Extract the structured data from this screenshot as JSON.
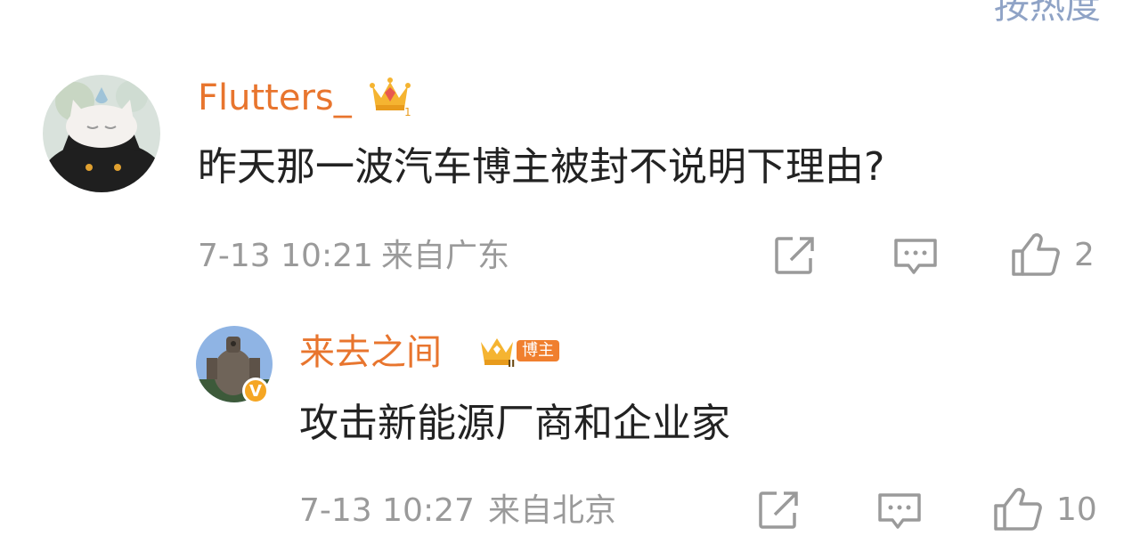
{
  "top_partial_text": "按热度",
  "comment": {
    "username": "Flutters_",
    "text": "昨天那一波汽车博主被封不说明下理由?",
    "time": "7-13 10:21",
    "location": "来自广东",
    "likes": "2",
    "badge_level": "1",
    "icons": {
      "repost": "share-icon",
      "comment": "comment-icon",
      "like": "thumbs-up-icon"
    }
  },
  "reply": {
    "username": "来去之间",
    "bozhu_tag": "博主",
    "text": "攻击新能源厂商和企业家",
    "time": "7-13 10:27",
    "location": "来自北京",
    "likes": "10",
    "badge_level": "II",
    "verified": "V"
  },
  "colors": {
    "username": "#e8752e",
    "meta": "#9a9a9a",
    "text": "#222222",
    "bozhu_tag": "#f07f2e",
    "link": "#8fa3c6"
  }
}
